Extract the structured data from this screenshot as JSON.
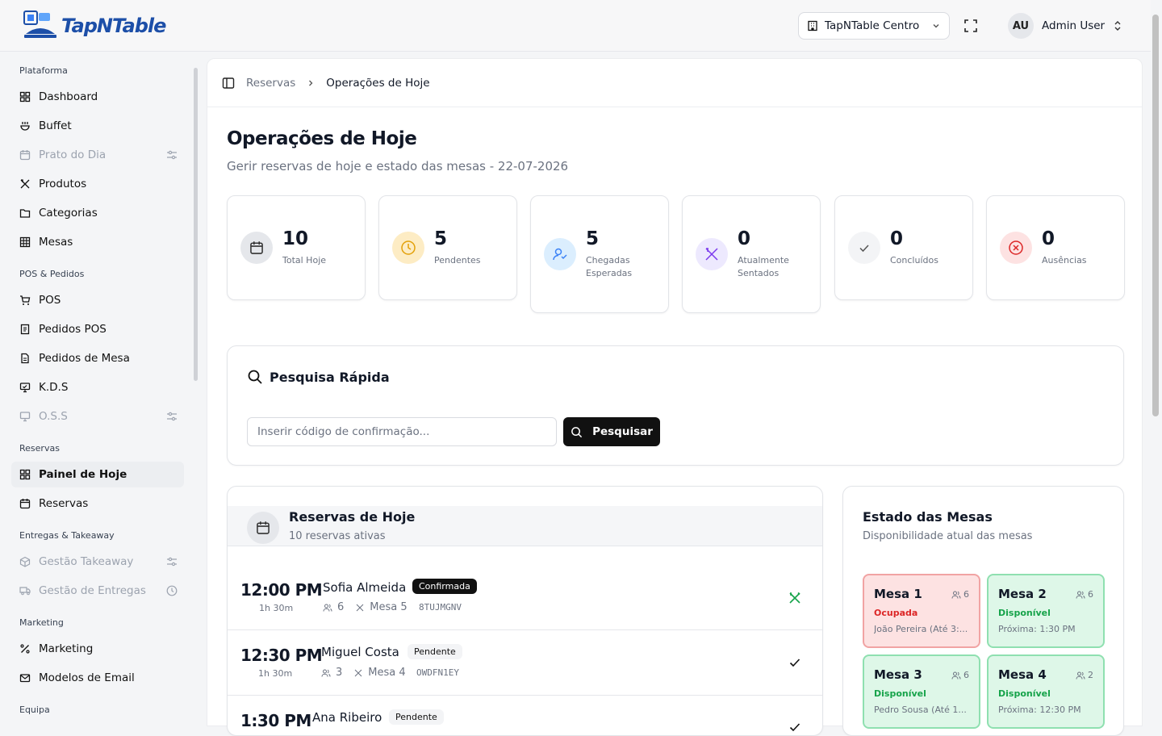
{
  "app": {
    "logo_text": "TapNTable"
  },
  "header": {
    "restaurant": "TapNTable Centro",
    "user_initials": "AU",
    "user_name": "Admin User"
  },
  "sidebar": {
    "sections": [
      {
        "title": "Plataforma",
        "items": [
          {
            "label": "Dashboard",
            "icon": "dashboard-icon"
          },
          {
            "label": "Buffet",
            "icon": "buffet-icon"
          },
          {
            "label": "Prato do Dia",
            "icon": "calendar-icon",
            "disabled": true
          },
          {
            "label": "Produtos",
            "icon": "utensils-icon"
          },
          {
            "label": "Categorias",
            "icon": "folder-icon"
          },
          {
            "label": "Mesas",
            "icon": "grid-icon"
          }
        ]
      },
      {
        "title": "POS & Pedidos",
        "items": [
          {
            "label": "POS",
            "icon": "cart-icon"
          },
          {
            "label": "Pedidos POS",
            "icon": "receipt-icon"
          },
          {
            "label": "Pedidos de Mesa",
            "icon": "document-icon"
          },
          {
            "label": "K.D.S",
            "icon": "monitor-icon"
          },
          {
            "label": "O.S.S",
            "icon": "screen-icon",
            "disabled": true
          }
        ]
      },
      {
        "title": "Reservas",
        "items": [
          {
            "label": "Painel de Hoje",
            "icon": "dashboard-icon",
            "active": true
          },
          {
            "label": "Reservas",
            "icon": "calendar-icon"
          }
        ]
      },
      {
        "title": "Entregas & Takeaway",
        "items": [
          {
            "label": "Gestão Takeaway",
            "icon": "box-icon",
            "disabled": true
          },
          {
            "label": "Gestão de Entregas",
            "icon": "truck-icon",
            "disabled": true
          }
        ]
      },
      {
        "title": "Marketing",
        "items": [
          {
            "label": "Marketing",
            "icon": "percent-icon"
          },
          {
            "label": "Modelos de Email",
            "icon": "mail-icon"
          }
        ]
      },
      {
        "title": "Equipa",
        "items": []
      }
    ]
  },
  "breadcrumb": {
    "parent": "Reservas",
    "current": "Operações de Hoje"
  },
  "page": {
    "title": "Operações de Hoje",
    "subtitle": "Gerir reservas de hoje e estado das mesas - 22-07-2026"
  },
  "stats": [
    {
      "value": "10",
      "label": "Total Hoje",
      "icon": "calendar-icon",
      "color": "#e5e7eb"
    },
    {
      "value": "5",
      "label": "Pendentes",
      "icon": "clock-icon",
      "color": "#fdecc4"
    },
    {
      "value": "5",
      "label": "Chegadas Esperadas",
      "icon": "user-check-icon",
      "color": "#dbeefe"
    },
    {
      "value": "0",
      "label": "Atualmente Sentados",
      "icon": "utensils-icon",
      "color": "#ede9fe"
    },
    {
      "value": "0",
      "label": "Concluídos",
      "icon": "check-icon",
      "color": "#f3f4f6"
    },
    {
      "value": "0",
      "label": "Ausências",
      "icon": "x-circle-icon",
      "color": "#fde2e2"
    }
  ],
  "quick_search": {
    "title": "Pesquisa Rápida",
    "placeholder": "Inserir código de confirmação...",
    "button": "Pesquisar"
  },
  "reservations": {
    "title": "Reservas de Hoje",
    "subtitle": "10 reservas ativas",
    "rows": [
      {
        "time": "12:00 PM",
        "duration": "1h 30m",
        "name": "Sofia Almeida",
        "status": "Confirmada",
        "guests": "6",
        "table": "Mesa 5",
        "code": "8TUJMGNV"
      },
      {
        "time": "12:30 PM",
        "duration": "1h 30m",
        "name": "Miguel Costa",
        "status": "Pendente",
        "guests": "3",
        "table": "Mesa 4",
        "code": "OWDFN1EY"
      },
      {
        "time": "1:30 PM",
        "duration": "",
        "name": "Ana Ribeiro",
        "status": "Pendente",
        "guests": "",
        "table": "",
        "code": ""
      }
    ]
  },
  "tables": {
    "title": "Estado das Mesas",
    "subtitle": "Disponibilidade atual das mesas",
    "items": [
      {
        "name": "Mesa 1",
        "capacity": "6",
        "status": "Ocupada",
        "next": "João Pereira  (Até 3:..."
      },
      {
        "name": "Mesa 2",
        "capacity": "6",
        "status": "Disponível",
        "next": "Próxima: 1:30 PM"
      },
      {
        "name": "Mesa 3",
        "capacity": "6",
        "status": "Disponível",
        "next": "Pedro Sousa  (Até 1..."
      },
      {
        "name": "Mesa 4",
        "capacity": "2",
        "status": "Disponível",
        "next": "Próxima: 12:30 PM"
      }
    ]
  }
}
